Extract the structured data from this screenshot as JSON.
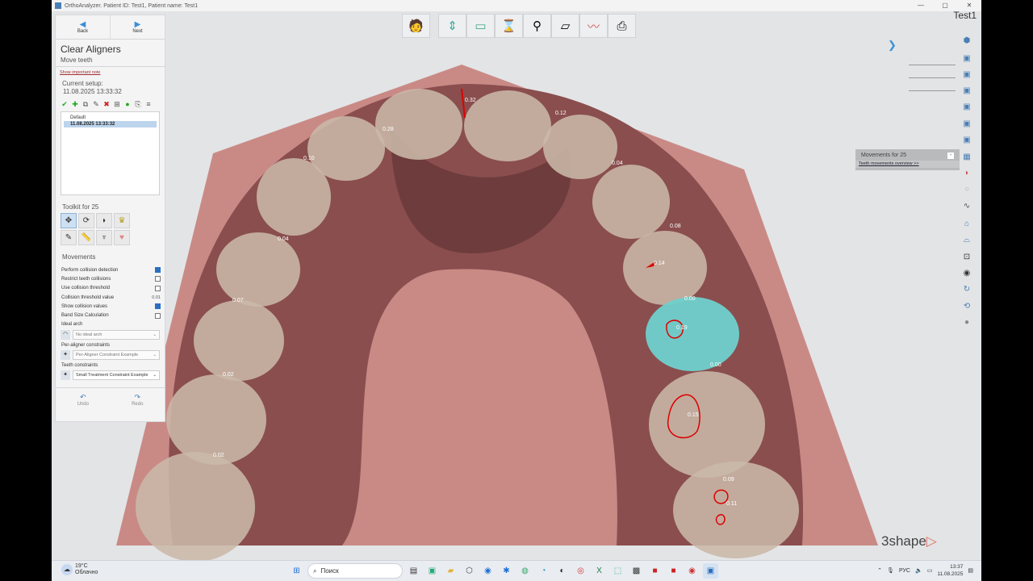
{
  "window": {
    "title": "OrthoAnalyzer. Patient ID: Test1, Patient name: Test1",
    "controls": [
      "—",
      "▢",
      "✕"
    ]
  },
  "nav": {
    "back": "Back",
    "next": "Next"
  },
  "panel": {
    "title": "Clear Aligners",
    "subtitle": "Move teeth",
    "important_note": "Show important note",
    "current_setup_label": "Current setup:",
    "current_setup_date": "11.08.2025   13:33:32",
    "setups": [
      {
        "label": "Default",
        "selected": false
      },
      {
        "label": "11.08.2025  13:33:32",
        "selected": true
      }
    ],
    "toolkit_title": "Toolkit for 25",
    "movements_title": "Movements",
    "options": [
      {
        "label": "Perform collision detection",
        "checked": true
      },
      {
        "label": "Restrict teeth collisions",
        "checked": false
      },
      {
        "label": "Use collision threshold",
        "checked": false
      },
      {
        "label": "Collision threshold value",
        "value": "0.01"
      },
      {
        "label": "Show collision values",
        "checked": true
      },
      {
        "label": "Band Size Calculation",
        "checked": false
      },
      {
        "label": "Ideal arch",
        "checked": null
      }
    ],
    "ideal_arch_value": "No ideal arch",
    "per_aligner_label": "Per-aligner constraints",
    "per_aligner_value": "Per-Aligner Constraint Example",
    "teeth_constraints_label": "Teeth constraints",
    "teeth_constraints_value": "Small Treatment Constraint Example",
    "undo": "Undo",
    "redo": "Redo"
  },
  "patient_name": "Test1",
  "movements_panel": {
    "title": "Movements for 25",
    "close": "-",
    "link": "Teeth movements overview >>"
  },
  "brand": {
    "text": "3shape",
    "mark": "▷"
  },
  "collision_labels": [
    "0.32",
    "0.28",
    "0.12",
    "0.10",
    "0.04",
    "0.08",
    "0.04",
    "0.14",
    "0.07",
    "0.00",
    "0.19",
    "0.00",
    "0.02",
    "0.15",
    "0.09",
    "0.11",
    "0.02"
  ],
  "taskbar": {
    "temperature": "19°C",
    "weather": "Облачно",
    "search": "Поиск",
    "lang": "РУС",
    "time": "13:37",
    "date": "11.08.2025"
  },
  "colors": {
    "gum": "#8a4e4e",
    "base": "#c98a86",
    "tooth": "#c9b8a8",
    "selected_tooth": "#6fd0cc",
    "accent": "#3b8fd6"
  }
}
